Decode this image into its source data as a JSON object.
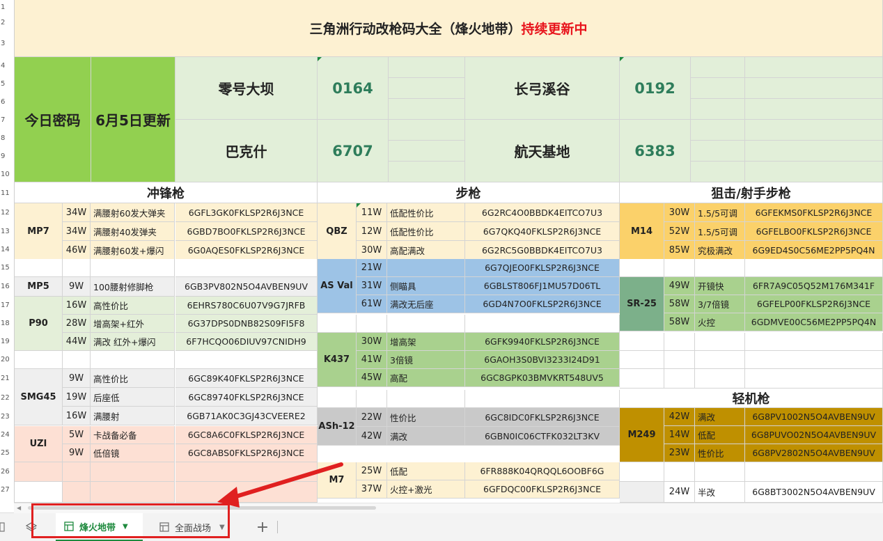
{
  "title": {
    "main": "三角洲行动改枪码大全（烽火地带）",
    "highlight": "持续更新中",
    "highlight_color": "#e8141c"
  },
  "password": {
    "label": "今日密码",
    "update": "6月5日更新",
    "maps": [
      {
        "name": "零号大坝",
        "code": "0164"
      },
      {
        "name": "长弓溪谷",
        "code": "0192"
      },
      {
        "name": "巴克什",
        "code": "6707"
      },
      {
        "name": "航天基地",
        "code": "6383"
      }
    ]
  },
  "sections": {
    "smg": "冲锋枪",
    "rifle": "步枪",
    "sniper": "狙击/射手步枪",
    "lmg": "轻机枪"
  },
  "smg": [
    {
      "gun": "MP7",
      "rows": [
        {
          "cost": "34W",
          "desc": "满腰射60发大弹夹",
          "code": "6GFL3GK0FKLSP2R6J3NCE"
        },
        {
          "cost": "34W",
          "desc": "满腰射40发弹夹",
          "code": "6GBD7BO0FKLSP2R6J3NCE"
        },
        {
          "cost": "46W",
          "desc": "满腰射60发+爆闪",
          "code": "6G0AQES0FKLSP2R6J3NCE"
        }
      ]
    },
    {
      "gun": "MP5",
      "rows": [
        {
          "cost": "9W",
          "desc": "100腰射修脚枪",
          "code": "6GB3PV802N5O4AVBEN9UV"
        }
      ]
    },
    {
      "gun": "P90",
      "rows": [
        {
          "cost": "16W",
          "desc": "高性价比",
          "code": "6EHRS780C6U07V9G7JRFB"
        },
        {
          "cost": "28W",
          "desc": "增高架+红外",
          "code": "6G37DPS0DNB82S09FI5F8"
        },
        {
          "cost": "44W",
          "desc": "满改 红外+爆闪",
          "code": "6F7HCQO06DIUV97CNIDH9"
        }
      ]
    },
    {
      "gun": "SMG45",
      "rows": [
        {
          "cost": "9W",
          "desc": "高性价比",
          "code": "6GC89K40FKLSP2R6J3NCE"
        },
        {
          "cost": "19W",
          "desc": "后座低",
          "code": "6GC89740FKLSP2R6J3NCE"
        },
        {
          "cost": "16W",
          "desc": "满腰射",
          "code": "6GB71AK0C3GJ43CVEERE2"
        }
      ]
    },
    {
      "gun": "UZI",
      "rows": [
        {
          "cost": "5W",
          "desc": "卡战备必备",
          "code": "6GC8A6C0FKLSP2R6J3NCE"
        },
        {
          "cost": "9W",
          "desc": "低倍镜",
          "code": "6GC8ABS0FKLSP2R6J3NCE"
        }
      ]
    }
  ],
  "rifle": [
    {
      "gun": "QBZ",
      "rows": [
        {
          "cost": "11W",
          "desc": "低配性价比",
          "code": "6G2RC4O0BBDK4EITCO7U3"
        },
        {
          "cost": "12W",
          "desc": "低配性价比",
          "code": "6G7QKQ40FKLSP2R6J3NCE"
        },
        {
          "cost": "30W",
          "desc": "高配满改",
          "code": "6G2RC5G0BBDK4EITCO7U3"
        }
      ]
    },
    {
      "gun": "AS Val",
      "rows": [
        {
          "cost": "21W",
          "desc": "",
          "code": "6G7QJEO0FKLSP2R6J3NCE"
        },
        {
          "cost": "31W",
          "desc": "侧瞄具",
          "code": "6GBLST806FJ1MU57D06TL"
        },
        {
          "cost": "61W",
          "desc": "满改无后座",
          "code": "6GD4N7O0FKLSP2R6J3NCE"
        }
      ]
    },
    {
      "gun": "K437",
      "rows": [
        {
          "cost": "30W",
          "desc": "增高架",
          "code": "6GFK9940FKLSP2R6J3NCE"
        },
        {
          "cost": "41W",
          "desc": "3倍镜",
          "code": "6GAOH3S0BVI3233I24D91"
        },
        {
          "cost": "45W",
          "desc": "高配",
          "code": "6GC8GPK03BMVKRT548UV5"
        }
      ]
    },
    {
      "gun": "ASh-12",
      "rows": [
        {
          "cost": "22W",
          "desc": "性价比",
          "code": "6GC8IDC0FKLSP2R6J3NCE"
        },
        {
          "cost": "42W",
          "desc": "满改",
          "code": "6GBN0IC06CTFK032LT3KV"
        }
      ]
    },
    {
      "gun": "M7",
      "rows": [
        {
          "cost": "25W",
          "desc": "低配",
          "code": "6FR888K04QRQQL6OOBF6G"
        },
        {
          "cost": "37W",
          "desc": "火控+激光",
          "code": "6GFDQC00FKLSP2R6J3NCE"
        }
      ]
    }
  ],
  "sniper": [
    {
      "gun": "M14",
      "rows": [
        {
          "cost": "30W",
          "desc": "1.5/5可调",
          "code": "6GFEKMS0FKLSP2R6J3NCE"
        },
        {
          "cost": "52W",
          "desc": "1.5/5可调",
          "code": "6GFELBO0FKLSP2R6J3NCE"
        },
        {
          "cost": "85W",
          "desc": "究极满改",
          "code": "6G9ED4S0C56ME2PP5PQ4N"
        }
      ]
    },
    {
      "gun": "SR-25",
      "rows": [
        {
          "cost": "49W",
          "desc": "开镜快",
          "code": "6FR7A9C05Q52M176M341F"
        },
        {
          "cost": "58W",
          "desc": "3/7倍镜",
          "code": "6GFELP00FKLSP2R6J3NCE"
        },
        {
          "cost": "58W",
          "desc": "火控",
          "code": "6GDMVE00C56ME2PP5PQ4N"
        }
      ]
    }
  ],
  "lmg": [
    {
      "gun": "M249",
      "rows": [
        {
          "cost": "42W",
          "desc": "满改",
          "code": "6G8PV1002N5O4AVBEN9UV"
        },
        {
          "cost": "14W",
          "desc": "低配",
          "code": "6G8PUVO02N5O4AVBEN9UV"
        },
        {
          "cost": "23W",
          "desc": "性价比",
          "code": "6G8PV2802N5O4AVBEN9UV"
        }
      ]
    },
    {
      "gun": "",
      "rows": [
        {
          "cost": "24W",
          "desc": "半改",
          "code": "6G8BT3002N5O4AVBEN9UV"
        }
      ]
    }
  ],
  "row_numbers": [
    "1",
    "2",
    "3",
    "4",
    "5",
    "6",
    "7",
    "8",
    "9",
    "10",
    "11",
    "12",
    "13",
    "14",
    "15",
    "16",
    "17",
    "18",
    "19",
    "20",
    "21",
    "22",
    "23",
    "24",
    "25",
    "26",
    "27"
  ],
  "tabs": [
    {
      "label": "烽火地带",
      "active": true
    },
    {
      "label": "全面战场",
      "active": false
    }
  ],
  "icons": {
    "menu": "sheets-menu-icon",
    "add": "add-sheet-icon"
  },
  "colors": {
    "header_bg": "#fdf1d2",
    "pw_green": "#92d050",
    "pw_light": "#e2efd9",
    "yellow": "#fde9a9",
    "blue": "#9dc3e6",
    "green": "#a9d18e",
    "gray": "#c9c9c9",
    "orange": "#fbd16a",
    "light_orange": "#fde0d4",
    "light_gray": "#efefef",
    "dark_gold": "#bf9000",
    "teal": "#7cb08a",
    "arrow": "#e02020"
  }
}
